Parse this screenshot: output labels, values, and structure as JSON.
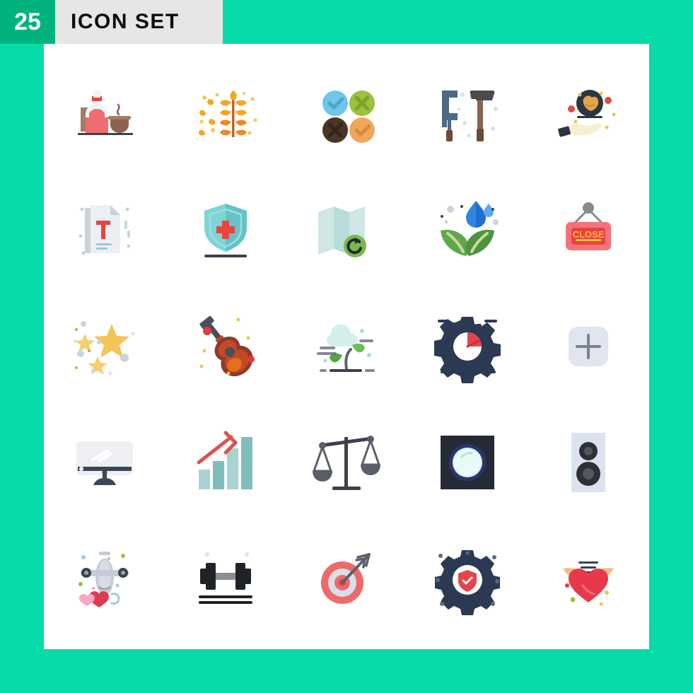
{
  "header": {
    "count": "25",
    "title": "ICON SET",
    "count_bg": "#00B37E",
    "bar_bg": "#E6E6E6",
    "title_color": "#0d0d0d"
  },
  "page": {
    "background": "#06DCA8",
    "panel_background": "#FFFFFF"
  },
  "grid": {
    "columns": 5,
    "rows": 5,
    "total": 25
  },
  "icons": [
    {
      "index": 1,
      "name": "bottle-and-cup-icon",
      "label": "Bottle and coffee cup",
      "colors": [
        "#EE6C72",
        "#F2F2F2",
        "#A57C62",
        "#8A6450"
      ]
    },
    {
      "index": 2,
      "name": "wheat-grain-icon",
      "label": "Wheat grain stalk",
      "colors": [
        "#F5A623",
        "#F9C74F",
        "#E98B2A"
      ]
    },
    {
      "index": 3,
      "name": "check-cross-circles-icon",
      "label": "Check and cross circles",
      "colors": [
        "#6CC7EA",
        "#9CC13B",
        "#4A3526",
        "#F0A75C"
      ]
    },
    {
      "index": 4,
      "name": "clamp-and-hammer-icon",
      "label": "Clamp and hammer tools",
      "colors": [
        "#4C6B85",
        "#4B4B4B",
        "#7A5C45"
      ]
    },
    {
      "index": 5,
      "name": "hand-holding-fried-chicken-icon",
      "label": "Hand holding fried chicken pan",
      "colors": [
        "#2E3440",
        "#E2A54C",
        "#F6EFD2",
        "#E24B3B"
      ]
    },
    {
      "index": 6,
      "name": "text-document-icon",
      "label": "Text document with T",
      "colors": [
        "#ECEFF4",
        "#CBD2DA",
        "#E9453F"
      ]
    },
    {
      "index": 7,
      "name": "medical-shield-icon",
      "label": "Medical shield",
      "colors": [
        "#7FD4D6",
        "#65C3C6",
        "#E9453F"
      ]
    },
    {
      "index": 8,
      "name": "map-refresh-icon",
      "label": "Map with refresh",
      "colors": [
        "#CFE6E3",
        "#B8DCD8",
        "#7BB74B",
        "#1F2B36"
      ]
    },
    {
      "index": 9,
      "name": "leaves-water-drop-icon",
      "label": "Leaves with water drops",
      "colors": [
        "#5FA84A",
        "#4C9440",
        "#2E86E0",
        "#1F6FD0"
      ]
    },
    {
      "index": 10,
      "name": "close-sign-icon",
      "label": "CLOSE hanging sign",
      "colors": [
        "#F4737A",
        "#EE3F45",
        "#FBBE3C",
        "#8A8A8A"
      ],
      "text": "CLOSE"
    },
    {
      "index": 11,
      "name": "stars-sparkle-icon",
      "label": "Stars and sparkles",
      "colors": [
        "#F6CF6D",
        "#F3C45A",
        "#CBD2E0"
      ]
    },
    {
      "index": 12,
      "name": "guitar-icon",
      "label": "Acoustic guitar",
      "colors": [
        "#8E3B26",
        "#C04A2A",
        "#E2701F",
        "#4A4F5A",
        "#E03A3A"
      ]
    },
    {
      "index": 13,
      "name": "sprout-cloud-icon",
      "label": "Plant sprout with cloud",
      "colors": [
        "#D4EFEA",
        "#6BBE55",
        "#50A83F",
        "#5A6472"
      ]
    },
    {
      "index": 14,
      "name": "gear-speedometer-icon",
      "label": "Gear with speedometer",
      "colors": [
        "#2B3A52",
        "#FFFFFF",
        "#E8424B"
      ]
    },
    {
      "index": 15,
      "name": "add-plus-square-icon",
      "label": "Add plus rounded square",
      "colors": [
        "#E1E5F0",
        "#7C8190"
      ]
    },
    {
      "index": 16,
      "name": "desktop-monitor-icon",
      "label": "Desktop monitor",
      "colors": [
        "#EDEFF2",
        "#3C4654",
        "#FFFFFF"
      ]
    },
    {
      "index": 17,
      "name": "growth-bar-chart-icon",
      "label": "Growth bar chart with arrow",
      "colors": [
        "#7FBDB8",
        "#A8D3CE",
        "#D9534F"
      ]
    },
    {
      "index": 18,
      "name": "balance-scale-icon",
      "label": "Balance scales of justice",
      "colors": [
        "#3C414C",
        "#5B6068"
      ]
    },
    {
      "index": 19,
      "name": "moon-night-icon",
      "label": "Moon on dark square",
      "colors": [
        "#262A36",
        "#2B3570",
        "#D9F2F0"
      ]
    },
    {
      "index": 20,
      "name": "speaker-icon",
      "label": "Audio speaker",
      "colors": [
        "#DCE2F0",
        "#2E3038",
        "#55575E"
      ]
    },
    {
      "index": 21,
      "name": "airplane-love-icon",
      "label": "Airplane with hearts",
      "colors": [
        "#C7CBD8",
        "#E03A4E",
        "#F5A8C0",
        "#9EC9E8"
      ]
    },
    {
      "index": 22,
      "name": "dumbbell-icon",
      "label": "Dumbbell weight",
      "colors": [
        "#1F2227",
        "#8A8D94"
      ]
    },
    {
      "index": 23,
      "name": "target-arrow-icon",
      "label": "Target with arrow",
      "colors": [
        "#ED6A6A",
        "#D9DEEA",
        "#E8414B",
        "#5B6068"
      ]
    },
    {
      "index": 24,
      "name": "gear-security-shield-icon",
      "label": "Gear with security shield",
      "colors": [
        "#2B3A52",
        "#FFFFFF",
        "#E8424B"
      ]
    },
    {
      "index": 25,
      "name": "winged-heart-icon",
      "label": "Heart with wings",
      "colors": [
        "#E8394C",
        "#F4BC82",
        "#3C414C"
      ]
    }
  ]
}
